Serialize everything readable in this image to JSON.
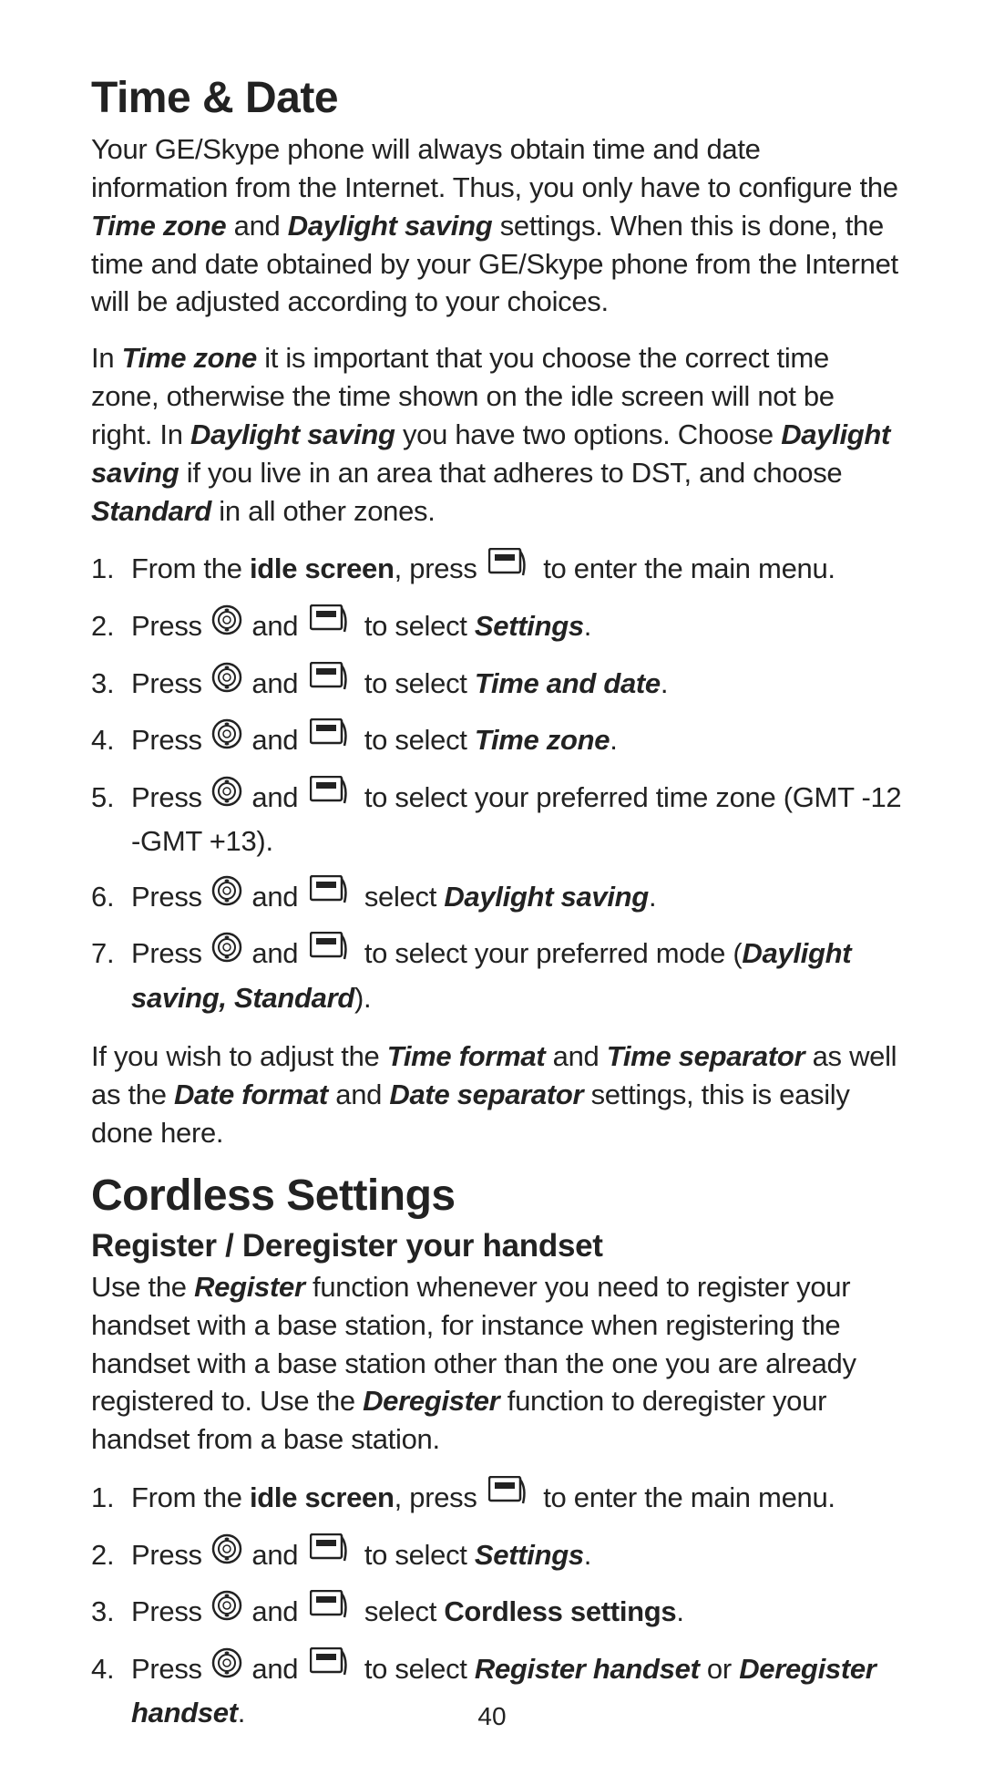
{
  "section1": {
    "title": "Time & Date",
    "para1": {
      "t1": "Your GE/Skype phone will always obtain time and date information from the Internet. Thus, you only have to configure the ",
      "b1": "Time zone",
      "t2": " and ",
      "b2": "Daylight saving",
      "t3": " settings. When this is done, the time and date obtained by your GE/Skype phone from the Internet will be adjusted according to your choices."
    },
    "para2": {
      "t1": "In ",
      "b1": "Time zone",
      "t2": " it is important that you choose the correct time zone, otherwise the time shown on the idle screen will not be right. In ",
      "b2": "Daylight saving",
      "t3": " you have two options. Choose ",
      "b3": "Daylight saving",
      "t4": " if you live in an area that adheres to DST, and choose ",
      "b4": "Standard",
      "t5": " in all other zones."
    },
    "steps": [
      {
        "num": "1.",
        "t1": "From the ",
        "b1": "idle screen",
        "t2": ", press ",
        "t3": " to enter the main menu."
      },
      {
        "num": "2.",
        "t1": "Press ",
        "t2": " and ",
        "t3": " to select ",
        "b1": "Settings",
        "t4": "."
      },
      {
        "num": "3.",
        "t1": "Press ",
        "t2": " and ",
        "t3": " to select ",
        "b1": "Time and date",
        "t4": "."
      },
      {
        "num": "4.",
        "t1": "Press ",
        "t2": " and ",
        "t3": " to select ",
        "b1": "Time zone",
        "t4": "."
      },
      {
        "num": "5.",
        "t1": "Press ",
        "t2": " and ",
        "t3": " to select your preferred time zone (GMT -12 -GMT +13)."
      },
      {
        "num": "6.",
        "t1": "Press ",
        "t2": " and ",
        "t3": " select ",
        "b1": "Daylight saving",
        "t4": "."
      },
      {
        "num": "7.",
        "t1": "Press ",
        "t2": " and ",
        "t3": " to select your preferred mode (",
        "b1": "Daylight saving, Standard",
        "t4": ")."
      }
    ],
    "para3": {
      "t1": "If you wish to adjust the ",
      "b1": "Time format",
      "t2": " and ",
      "b2": "Time separator",
      "t3": " as well as the ",
      "b3": "Date format",
      "t4": " and ",
      "b4": "Date separator",
      "t5": " settings, this is easily done here."
    }
  },
  "section2": {
    "title": "Cordless Settings",
    "subtitle": "Register / Deregister your handset",
    "para1": {
      "t1": "Use the ",
      "b1": "Register",
      "t2": " function whenever you need to register your handset with a base station, for instance when registering the handset with a base station other than the one you are already registered to. Use the ",
      "b2": "Deregister",
      "t3": " function to deregister your handset from a base station."
    },
    "steps": [
      {
        "num": "1.",
        "t1": "From the ",
        "b1": "idle screen",
        "t2": ", press ",
        "t3": " to enter the main menu."
      },
      {
        "num": "2.",
        "t1": "Press ",
        "t2": " and ",
        "t3": " to select ",
        "b1": "Settings",
        "t4": "."
      },
      {
        "num": "3.",
        "t1": "Press ",
        "t2": " and ",
        "t3": " select ",
        "b1": "Cordless settings",
        "t4": "."
      },
      {
        "num": "4.",
        "t1": "Press ",
        "t2": " and ",
        "t3": " to select ",
        "b1": "Register handset",
        "t4": " or ",
        "b2": "Deregister handset",
        "t5": "."
      }
    ]
  },
  "pageNumber": "40"
}
